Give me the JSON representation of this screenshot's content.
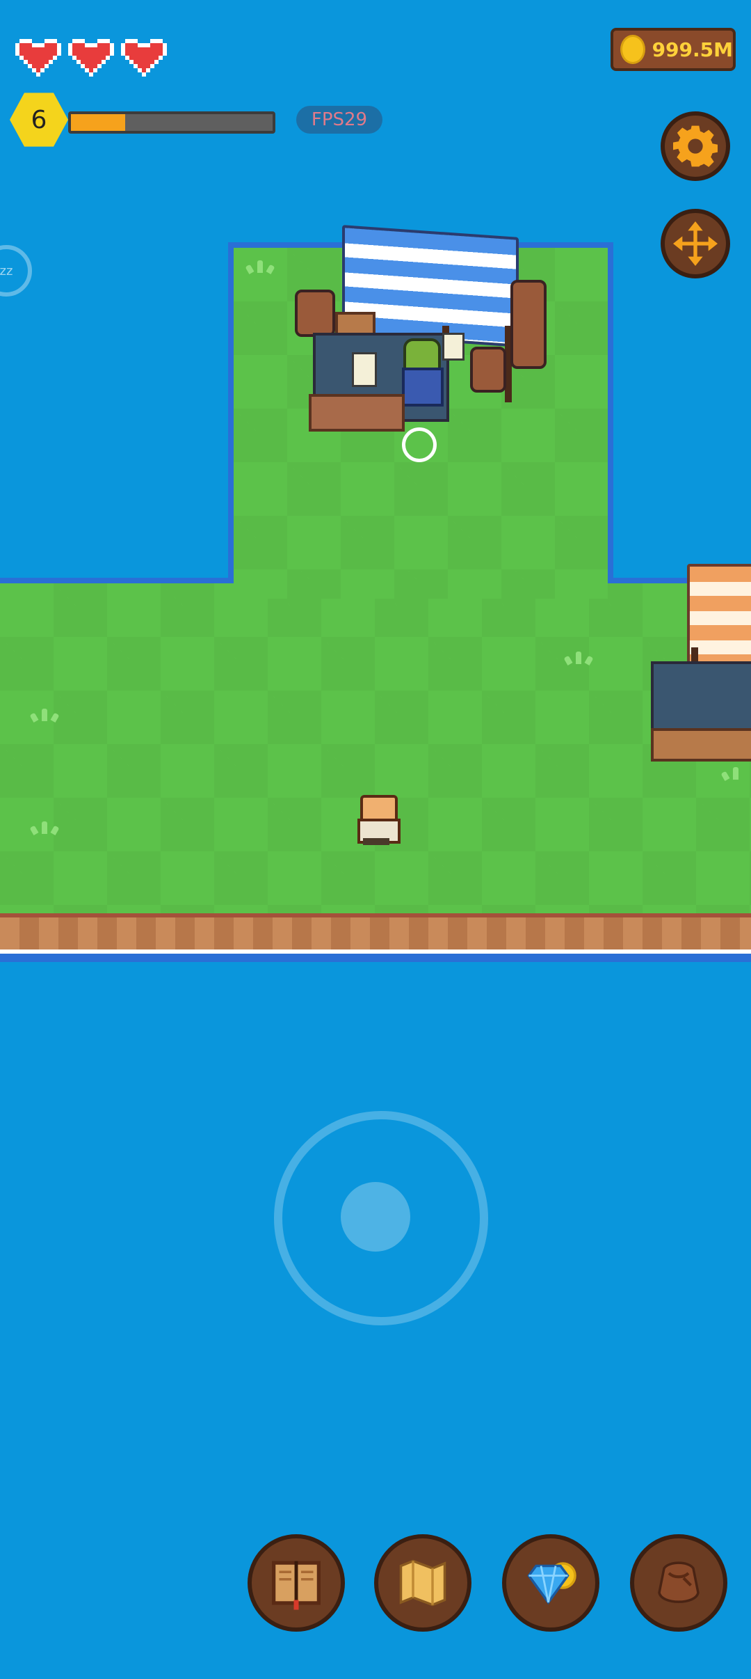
{
  "hud": {
    "hearts": {
      "filled": 3,
      "total": 3,
      "color": "#e83c3c"
    },
    "level": "6",
    "xp_progress": 0.27,
    "fps_label": "FPS29",
    "coins": "999.5M",
    "sleep_label": "zz"
  },
  "side_buttons": [
    {
      "name": "settings-button",
      "icon": "gear-icon"
    },
    {
      "name": "move-mode-button",
      "icon": "move-arrows-icon"
    }
  ],
  "bottom_bar": [
    {
      "name": "journal-button",
      "icon": "book-icon"
    },
    {
      "name": "map-button",
      "icon": "map-scroll-icon"
    },
    {
      "name": "shop-button",
      "icon": "gem-coin-icon"
    },
    {
      "name": "inventory-button",
      "icon": "leather-bag-icon"
    }
  ],
  "colors": {
    "water": "#0a96dc",
    "grass": "#5cc24a",
    "accent_gold": "#f4d41c",
    "xp_fill": "#f6a21c",
    "button_wood": "#6b3c22"
  }
}
